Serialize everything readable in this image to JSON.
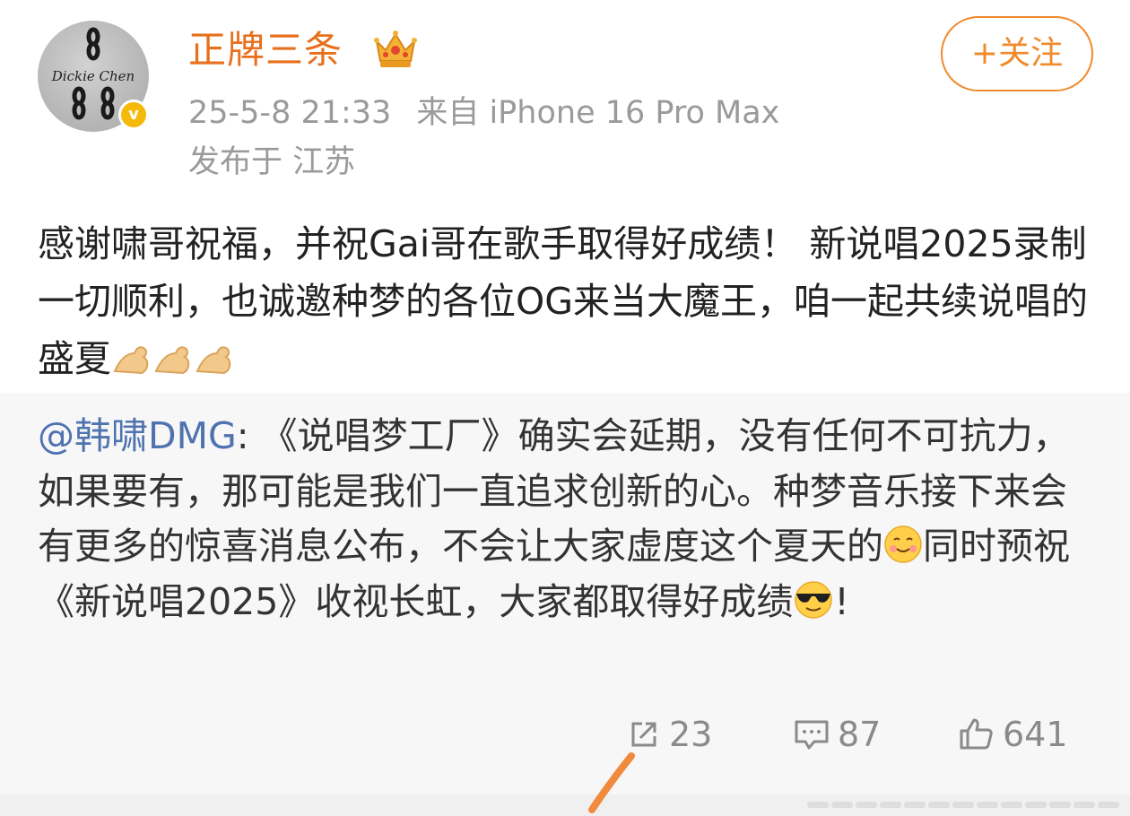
{
  "header": {
    "avatar_text": "Dickie Chen",
    "username": "正牌三条",
    "crown_icon": "crown-icon",
    "verified_badge": "v",
    "follow_button": "+关注",
    "timestamp": "25-5-8 21:33",
    "source": "来自 iPhone 16 Pro Max",
    "location": "发布于 江苏"
  },
  "post": {
    "text": "感谢啸哥祝福，并祝Gai哥在歌手取得好成绩！ 新说唱2025录制一切顺利，也诚邀种梦的各位OG来当大魔王，咱一起共续说唱的盛夏",
    "emoji_icon": "flexed-biceps-icon"
  },
  "repost": {
    "mention": "@韩啸DMG",
    "text_part1": ": 《说唱梦工厂》确实会延期，没有任何不可抗力，如果要有，那可能是我们一直追求创新的心。种梦音乐接下来会有更多的惊喜消息公布，不会让大家虚度这个夏天的",
    "text_part2": "同时预祝《新说唱2025》收视长虹，大家都取得好成绩",
    "text_part3": "!",
    "emoji1": "smiling-face-icon",
    "emoji2": "sunglasses-face-icon"
  },
  "actions": {
    "repost_count": "23",
    "comment_count": "87",
    "like_count": "641"
  },
  "colors": {
    "username": "#e86f1c",
    "follow": "#f08a2b",
    "mention": "#5073b0",
    "repost_bg": "#f7f7f7",
    "meta": "#9a9a9a",
    "annotation_stroke": "#f08a3c"
  }
}
